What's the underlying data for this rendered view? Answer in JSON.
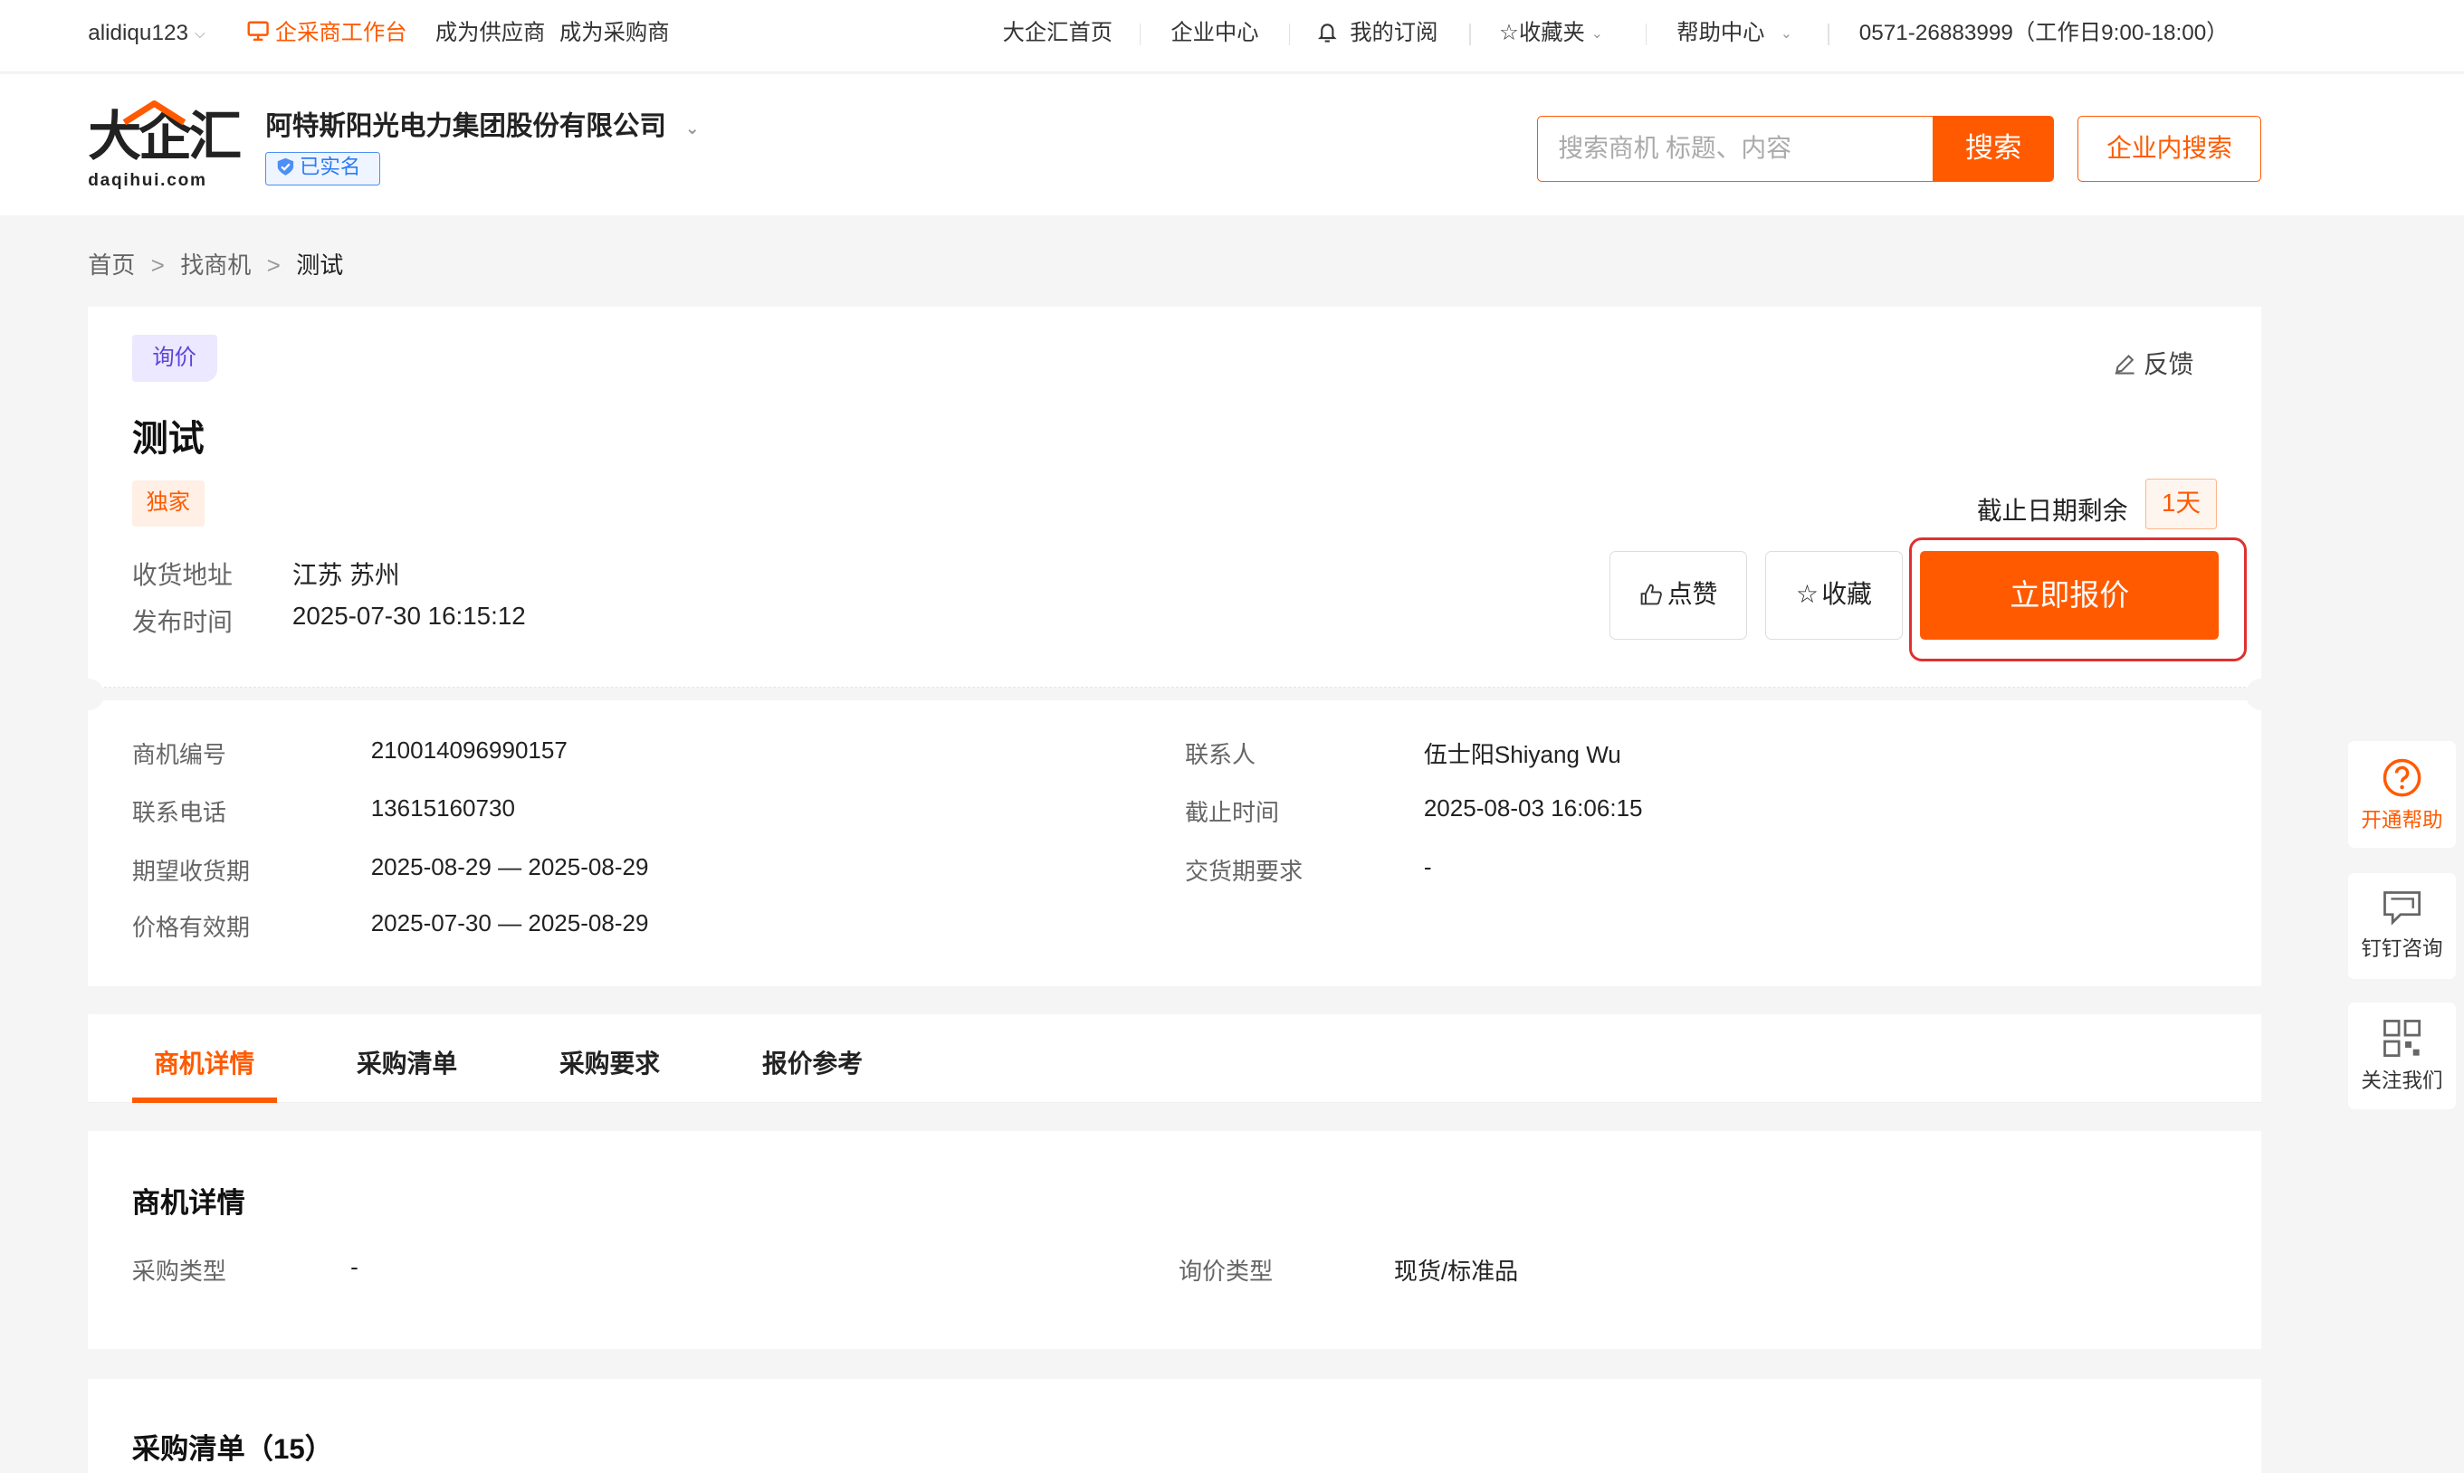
{
  "topbar": {
    "username": "alidiqu123",
    "workbench": "企采商工作台",
    "become_supplier": "成为供应商",
    "become_purchaser": "成为采购商",
    "home": "大企汇首页",
    "enterprise_center": "企业中心",
    "subscription": "我的订阅",
    "favorites": "收藏夹",
    "help_center": "帮助中心",
    "hotline": "0571-26883999（工作日9:00-18:00）"
  },
  "header": {
    "logo_cn": "大企汇",
    "logo_en": "daqihui.com",
    "company": "阿特斯阳光电力集团股份有限公司",
    "verified": "已实名",
    "search_placeholder": "搜索商机 标题、内容",
    "search_button": "搜索",
    "inner_search_button": "企业内搜索"
  },
  "breadcrumb": [
    "首页",
    "找商机",
    "测试"
  ],
  "opportunity": {
    "type_tag": "询价",
    "feedback": "反馈",
    "title": "测试",
    "exclusive_tag": "独家",
    "address_label": "收货地址",
    "address": "江苏 苏州",
    "publish_label": "发布时间",
    "publish_time": "2025-07-30 16:15:12",
    "deadline_label": "截止日期剩余",
    "deadline_remaining": "1天",
    "like": "点赞",
    "collect": "收藏",
    "quote_now": "立即报价"
  },
  "info": {
    "left": [
      {
        "label": "商机编号",
        "value": "210014096990157"
      },
      {
        "label": "联系电话",
        "value": "13615160730"
      },
      {
        "label": "期望收货期",
        "value": "2025-08-29 — 2025-08-29"
      },
      {
        "label": "价格有效期",
        "value": "2025-07-30 — 2025-08-29"
      }
    ],
    "right": [
      {
        "label": "联系人",
        "value": "伍士阳Shiyang Wu"
      },
      {
        "label": "截止时间",
        "value": "2025-08-03 16:06:15"
      },
      {
        "label": "交货期要求",
        "value": "-"
      }
    ]
  },
  "tabs": [
    "商机详情",
    "采购清单",
    "采购要求",
    "报价参考"
  ],
  "details": {
    "title": "商机详情",
    "purchase_type_label": "采购类型",
    "purchase_type": "-",
    "inquiry_type_label": "询价类型",
    "inquiry_type": "现货/标准品"
  },
  "purchase_list": {
    "title": "采购清单（15）"
  },
  "float": {
    "help": "开通帮助",
    "dingtalk": "钉钉咨询",
    "follow": "关注我们"
  },
  "colors": {
    "accent": "#ff5a00",
    "highlight": "#e03030",
    "verified": "#2d7bf5"
  }
}
